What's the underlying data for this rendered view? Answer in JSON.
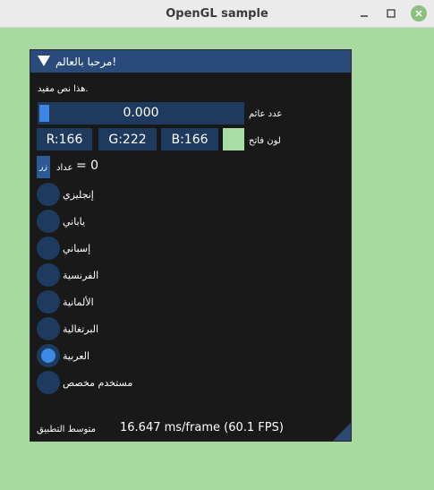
{
  "window": {
    "title": "OpenGL sample"
  },
  "imgui": {
    "title": "مرحبا بالعالم!",
    "help_text": "هذا نص مفيد.",
    "slider": {
      "value": "0.000",
      "label": "عدد عائم",
      "fraction": 0.0
    },
    "color": {
      "r": "R:166",
      "g": "G:222",
      "b": "B:166",
      "label": "لون فاتح",
      "hex": "#a6dea6"
    },
    "button": {
      "label": "زر"
    },
    "counter": {
      "label": "عداد",
      "value": "= 0"
    },
    "languages": [
      {
        "label": "إنجليزي",
        "selected": false
      },
      {
        "label": "ياباني",
        "selected": false
      },
      {
        "label": "إسباني",
        "selected": false
      },
      {
        "label": "الفرنسية",
        "selected": false
      },
      {
        "label": "الألمانية",
        "selected": false
      },
      {
        "label": "البرتغالية",
        "selected": false
      },
      {
        "label": "العربية",
        "selected": true
      },
      {
        "label": "مستخدم مخصص",
        "selected": false
      }
    ],
    "footer": {
      "label": "متوسط التطبيق",
      "value": "16.647 ms/frame (60.1 FPS)"
    }
  },
  "colors": {
    "background": "#a7d9a0",
    "frame_bg": "#1f3a5f",
    "title_bg": "#294a7a",
    "accent": "#3d8ae6"
  }
}
